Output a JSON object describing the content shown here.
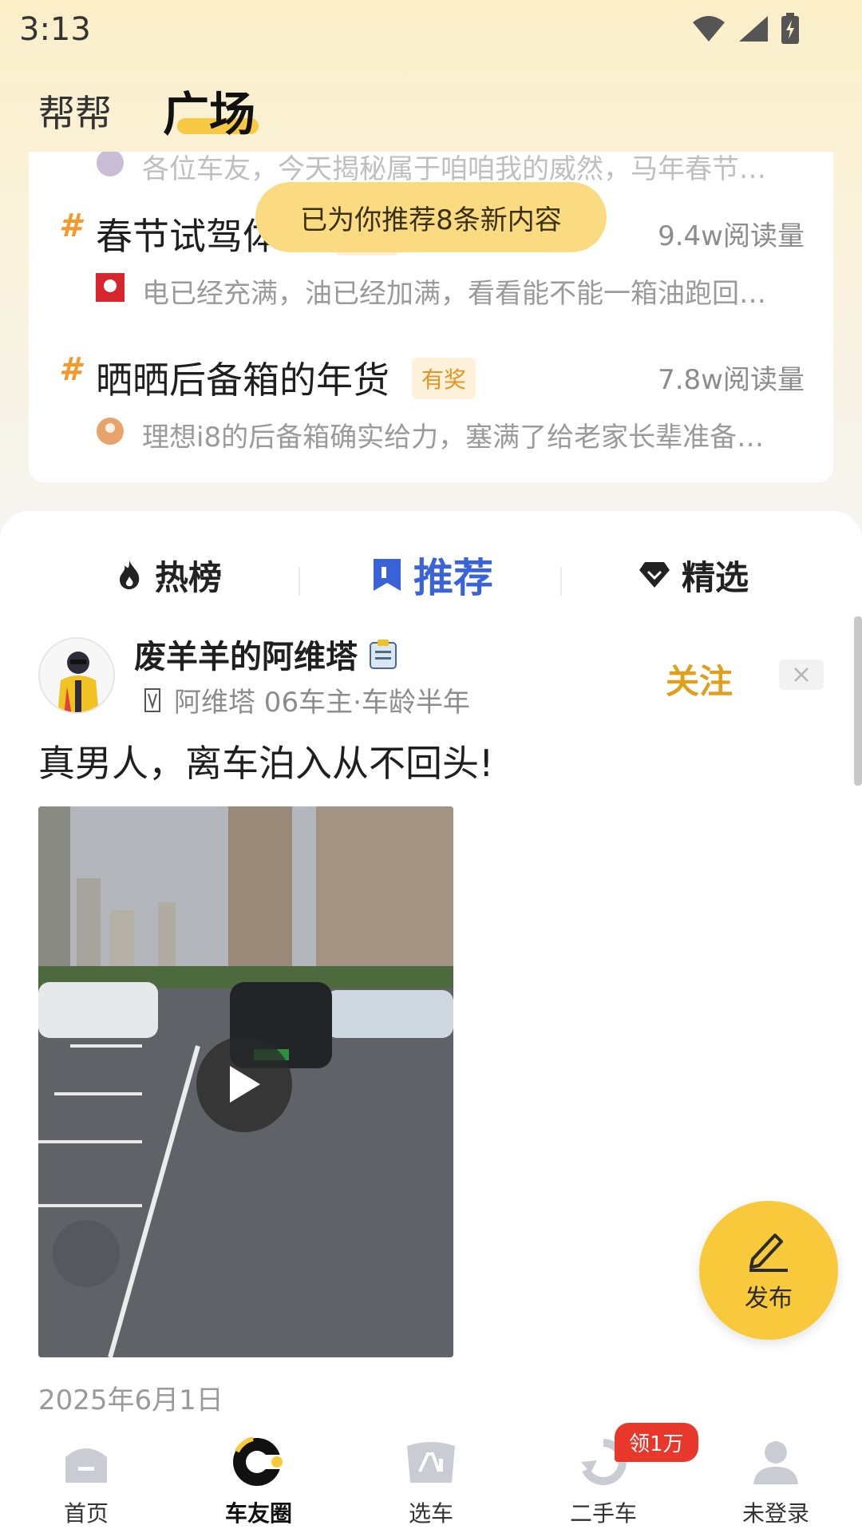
{
  "status_bar": {
    "time": "3:13"
  },
  "top_tabs": {
    "bangbang": "帮帮",
    "guangchang": "广场"
  },
  "toast": "已为你推荐8条新内容",
  "topics": [
    {
      "hash": "#",
      "title": "春节试驾体验",
      "badge": "有奖",
      "reads": "9.4w阅读量",
      "snippet": "电已经充满，油已经加满，看看能不能一箱油跑回…"
    },
    {
      "hash": "#",
      "title": "晒晒后备箱的年货",
      "badge": "有奖",
      "reads": "7.8w阅读量",
      "snippet": "理想i8的后备箱确实给力，塞满了给老家长辈准备…"
    }
  ],
  "topic_partial_snippet": "各位车友，今天揭秘属于咱咱我的威然，马年春节…",
  "feed_tabs": [
    {
      "label": "热榜",
      "icon": "flame-icon"
    },
    {
      "label": "推荐",
      "icon": "flag-icon",
      "active": true
    },
    {
      "label": "精选",
      "icon": "diamond-icon"
    }
  ],
  "post": {
    "author": "废羊羊的阿维塔",
    "meta": "阿维塔 06车主·车龄半年",
    "follow_label": "关注",
    "text": "真男人，离车泊入从不回头!",
    "date": "2025年6月1日"
  },
  "publish_label": "发布",
  "bottom_nav": [
    {
      "label": "首页",
      "icon": "home-icon"
    },
    {
      "label": "车友圈",
      "icon": "circle-icon",
      "active": true
    },
    {
      "label": "选车",
      "icon": "car-select-icon"
    },
    {
      "label": "二手车",
      "icon": "recycle-icon"
    },
    {
      "label": "未登录",
      "icon": "user-icon"
    }
  ],
  "nav_badge": "领1万",
  "colors": {
    "accent_yellow": "#f8c93a",
    "active_blue": "#3b63d8",
    "badge_red": "#e7382b",
    "follow_gold": "#e0a01c"
  }
}
